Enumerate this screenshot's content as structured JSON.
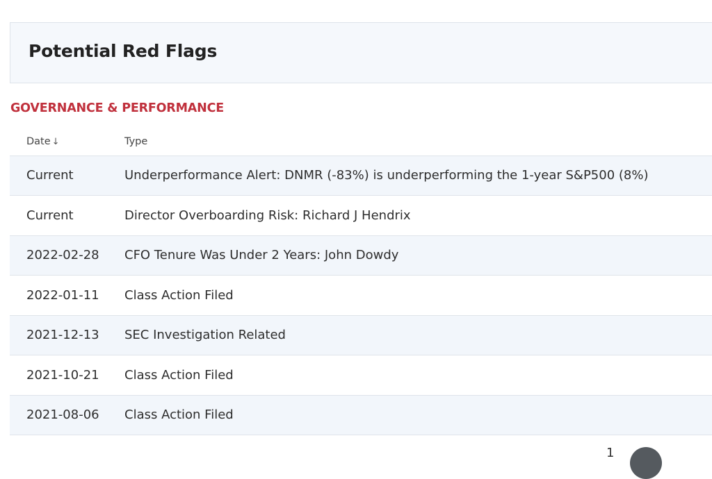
{
  "panel": {
    "title": "Potential Red Flags"
  },
  "section": {
    "label": "GOVERNANCE & PERFORMANCE"
  },
  "table": {
    "columns": {
      "date": "Date",
      "date_sort_indicator": "↓",
      "type": "Type"
    },
    "rows": [
      {
        "date": "Current",
        "type": "Underperformance Alert: DNMR (-83%) is underperforming the 1-year S&P500 (8%)"
      },
      {
        "date": "Current",
        "type": "Director Overboarding Risk: Richard J Hendrix"
      },
      {
        "date": "2022-02-28",
        "type": "CFO Tenure Was Under 2 Years: John Dowdy"
      },
      {
        "date": "2022-01-11",
        "type": "Class Action Filed"
      },
      {
        "date": "2021-12-13",
        "type": "SEC Investigation Related"
      },
      {
        "date": "2021-10-21",
        "type": "Class Action Filed"
      },
      {
        "date": "2021-08-06",
        "type": "Class Action Filed"
      }
    ]
  },
  "pagination": {
    "current_page": "1"
  }
}
